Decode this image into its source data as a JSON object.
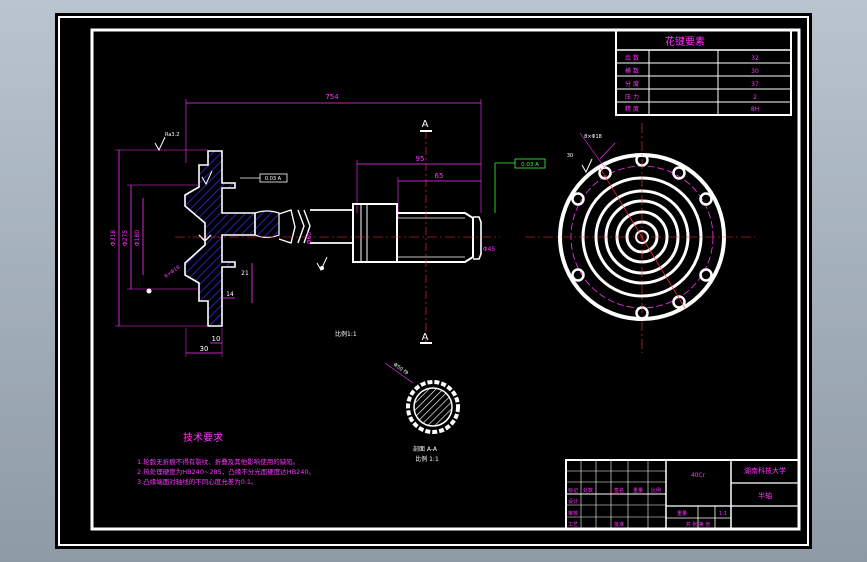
{
  "spline_table": {
    "title": "花键要素",
    "rows": [
      {
        "label": "齿 数",
        "value": "32"
      },
      {
        "label": "模 数",
        "value": "30"
      },
      {
        "label": "分 度",
        "value": "37"
      },
      {
        "label": "压 力",
        "value": "2"
      },
      {
        "label": "精 度",
        "value": "8H"
      }
    ]
  },
  "dimensions": {
    "overall_length": "754",
    "len_95": "95",
    "len_65": "65",
    "len_30": "30",
    "len_10": "10",
    "len_21": "21",
    "len_14": "14",
    "diam_left_1": "Φ318",
    "diam_left_2": "Φ275",
    "diam_left_3": "Φ180",
    "diam_shaft": "Φ60",
    "diam_end": "Φ45",
    "spline_spec": "Φ50 f9",
    "roughness": "Ra3.2",
    "tol_frame": "0.03 A",
    "hole_label": "8×Φ18"
  },
  "section": {
    "marker": "A",
    "label_top": "A-A",
    "label_bottom": "1:1",
    "caption": "剖面 A-A",
    "scale": "比例 1:1",
    "main_view_caption": "比例1:1"
  },
  "tech_requirements": {
    "title": "技术要求",
    "items": [
      "1.轮毂无折痕不得有裂纹、折叠及其他影响使用的缺陷。",
      "2.热处理硬度为HB240~285，凸缘不分光面硬度达HB240。",
      "3.凸缘端面对轴线的不同心度允差为0.1。"
    ]
  },
  "title_block": {
    "part_name": "半轴",
    "school": "湖南科技大学",
    "material": "40Cr",
    "scale": "1:1",
    "mark_left": "标记",
    "mark_drawn": "设计",
    "mark_check": "审核",
    "mark_process": "工艺",
    "mark_approve": "批准",
    "mark_count": "处数",
    "mark_sign": "签名",
    "mark_weight": "重量",
    "mark_ratio": "比例",
    "sheet": "共 张 第 张"
  },
  "colors": {
    "outline": "#ffffff",
    "dim": "#ff33ff",
    "center": "#ff3333",
    "hatch": "#3333ff",
    "tag": "#33ff33"
  }
}
